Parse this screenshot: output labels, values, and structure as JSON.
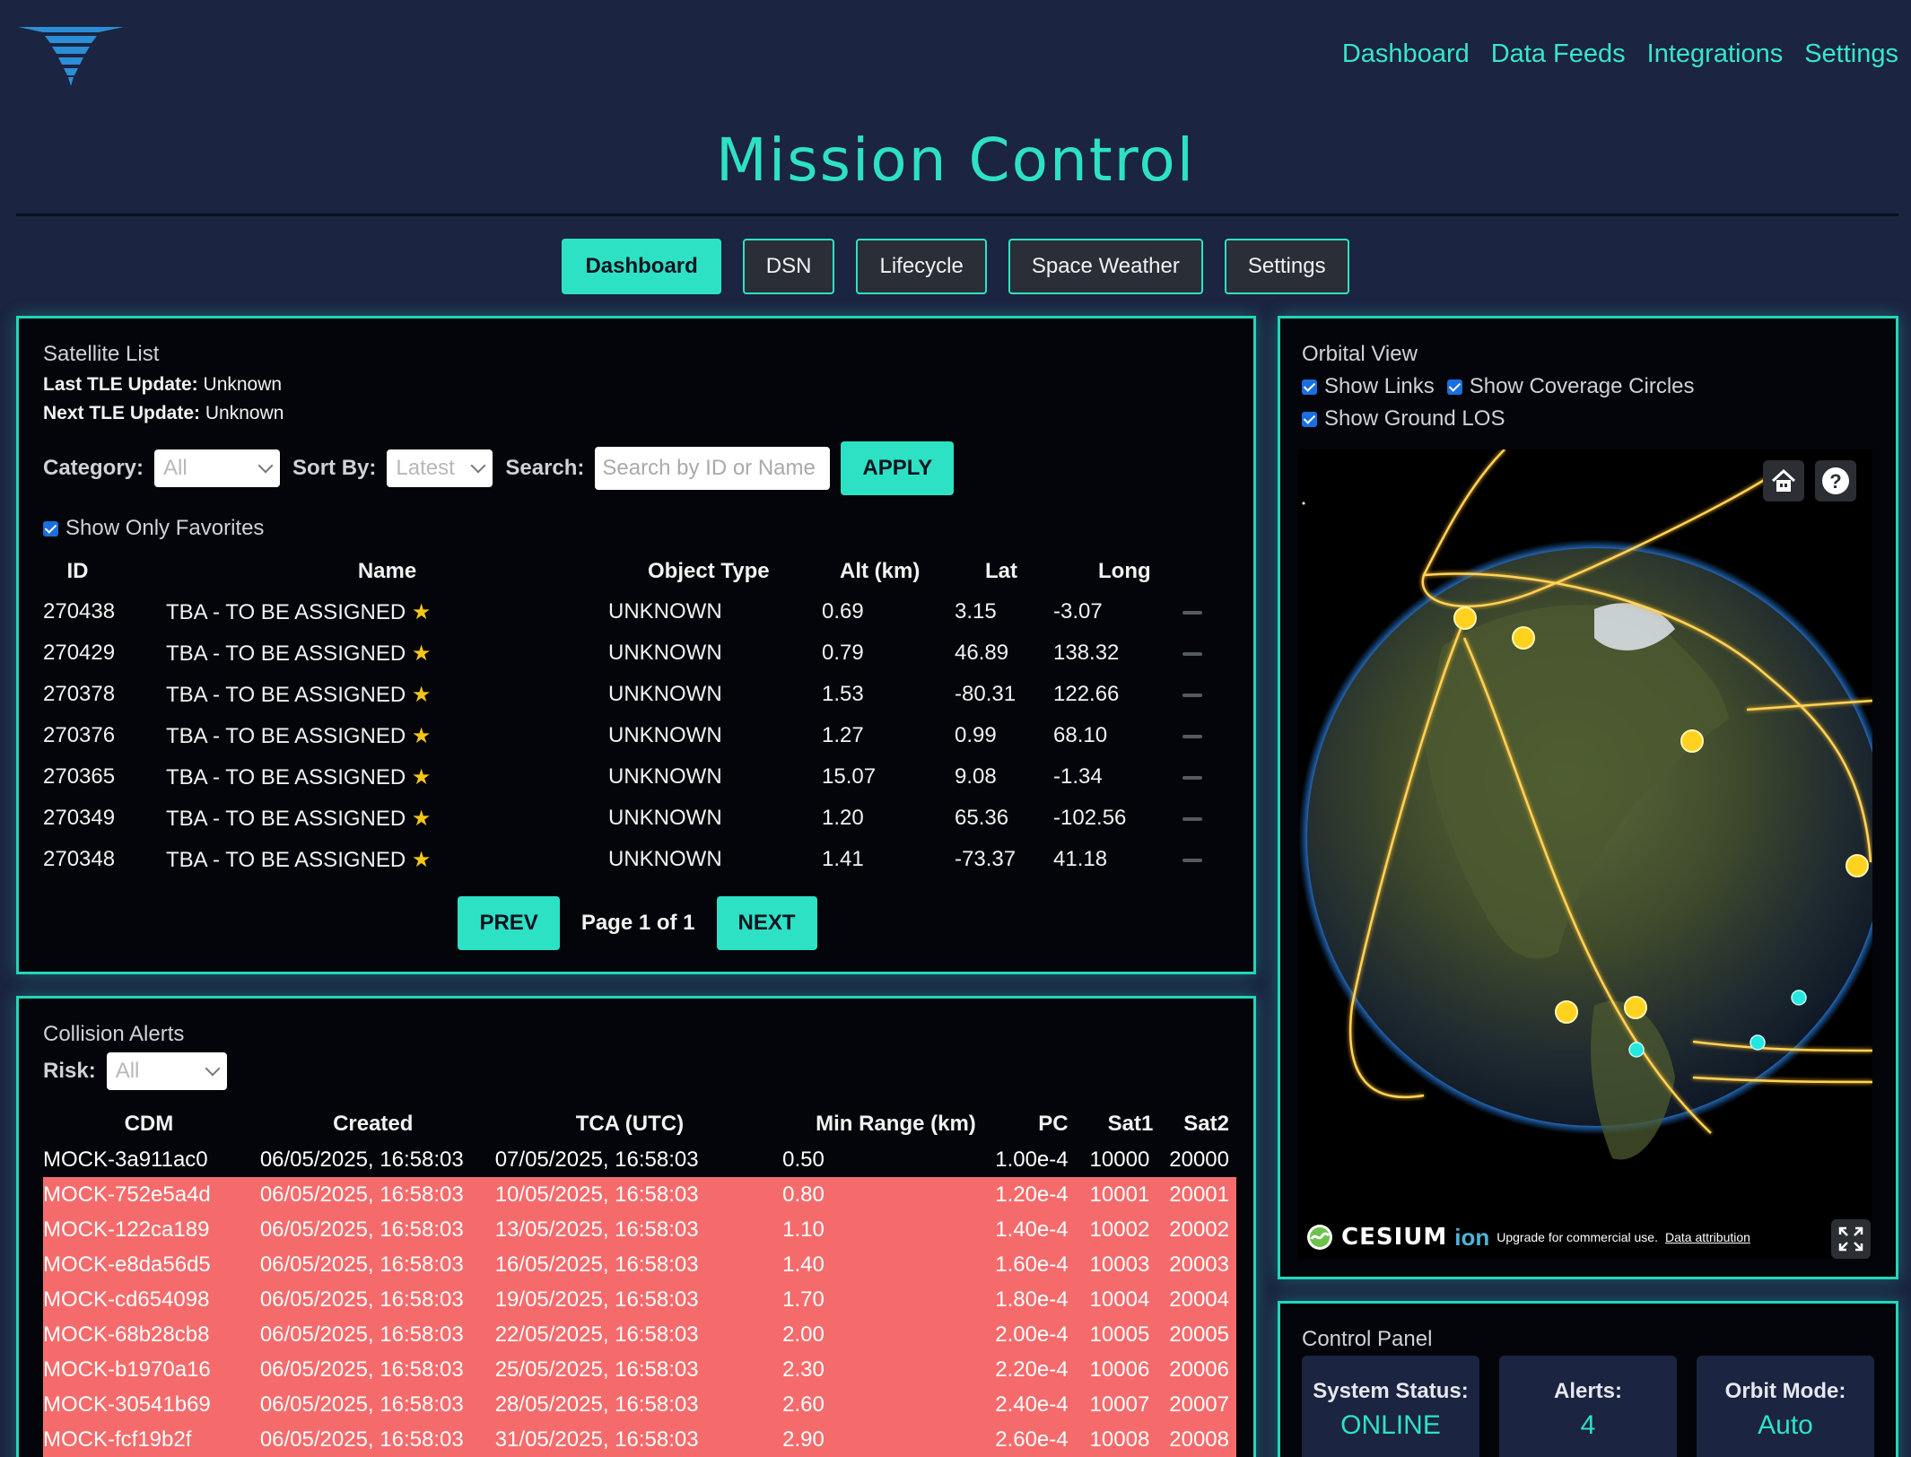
{
  "nav": {
    "links": [
      "Dashboard",
      "Data Feeds",
      "Integrations",
      "Settings"
    ]
  },
  "title": "Mission Control",
  "tabs": [
    "Dashboard",
    "DSN",
    "Lifecycle",
    "Space Weather",
    "Settings"
  ],
  "active_tab": "Dashboard",
  "satellite_list": {
    "title": "Satellite List",
    "last_tle_label": "Last TLE Update:",
    "last_tle_value": "Unknown",
    "next_tle_label": "Next TLE Update:",
    "next_tle_value": "Unknown",
    "category_label": "Category:",
    "category_value": "All",
    "sort_label": "Sort By:",
    "sort_value": "Latest",
    "search_label": "Search:",
    "search_placeholder": "Search by ID or Name",
    "apply_label": "APPLY",
    "favorites_label": "Show Only Favorites",
    "columns": [
      "ID",
      "Name",
      "Object Type",
      "Alt (km)",
      "Lat",
      "Long"
    ],
    "rows": [
      {
        "id": "270438",
        "name": "TBA - TO BE ASSIGNED",
        "type": "UNKNOWN",
        "alt": "0.69",
        "lat": "3.15",
        "long": "-3.07"
      },
      {
        "id": "270429",
        "name": "TBA - TO BE ASSIGNED",
        "type": "UNKNOWN",
        "alt": "0.79",
        "lat": "46.89",
        "long": "138.32"
      },
      {
        "id": "270378",
        "name": "TBA - TO BE ASSIGNED",
        "type": "UNKNOWN",
        "alt": "1.53",
        "lat": "-80.31",
        "long": "122.66"
      },
      {
        "id": "270376",
        "name": "TBA - TO BE ASSIGNED",
        "type": "UNKNOWN",
        "alt": "1.27",
        "lat": "0.99",
        "long": "68.10"
      },
      {
        "id": "270365",
        "name": "TBA - TO BE ASSIGNED",
        "type": "UNKNOWN",
        "alt": "15.07",
        "lat": "9.08",
        "long": "-1.34"
      },
      {
        "id": "270349",
        "name": "TBA - TO BE ASSIGNED",
        "type": "UNKNOWN",
        "alt": "1.20",
        "lat": "65.36",
        "long": "-102.56"
      },
      {
        "id": "270348",
        "name": "TBA - TO BE ASSIGNED",
        "type": "UNKNOWN",
        "alt": "1.41",
        "lat": "-73.37",
        "long": "41.18"
      }
    ],
    "prev_label": "PREV",
    "next_label": "NEXT",
    "page_text": "Page 1 of 1"
  },
  "collision_alerts": {
    "title": "Collision Alerts",
    "risk_label": "Risk:",
    "risk_value": "All",
    "columns": [
      "CDM",
      "Created",
      "TCA (UTC)",
      "Min Range (km)",
      "PC",
      "Sat1",
      "Sat2"
    ],
    "rows": [
      {
        "cdm": "MOCK-3a911ac0",
        "created": "06/05/2025, 16:58:03",
        "tca": "07/05/2025, 16:58:03",
        "range": "0.50",
        "pc": "1.00e-4",
        "sat1": "10000",
        "sat2": "20000",
        "high": false
      },
      {
        "cdm": "MOCK-752e5a4d",
        "created": "06/05/2025, 16:58:03",
        "tca": "10/05/2025, 16:58:03",
        "range": "0.80",
        "pc": "1.20e-4",
        "sat1": "10001",
        "sat2": "20001",
        "high": true
      },
      {
        "cdm": "MOCK-122ca189",
        "created": "06/05/2025, 16:58:03",
        "tca": "13/05/2025, 16:58:03",
        "range": "1.10",
        "pc": "1.40e-4",
        "sat1": "10002",
        "sat2": "20002",
        "high": true
      },
      {
        "cdm": "MOCK-e8da56d5",
        "created": "06/05/2025, 16:58:03",
        "tca": "16/05/2025, 16:58:03",
        "range": "1.40",
        "pc": "1.60e-4",
        "sat1": "10003",
        "sat2": "20003",
        "high": true
      },
      {
        "cdm": "MOCK-cd654098",
        "created": "06/05/2025, 16:58:03",
        "tca": "19/05/2025, 16:58:03",
        "range": "1.70",
        "pc": "1.80e-4",
        "sat1": "10004",
        "sat2": "20004",
        "high": true
      },
      {
        "cdm": "MOCK-68b28cb8",
        "created": "06/05/2025, 16:58:03",
        "tca": "22/05/2025, 16:58:03",
        "range": "2.00",
        "pc": "2.00e-4",
        "sat1": "10005",
        "sat2": "20005",
        "high": true
      },
      {
        "cdm": "MOCK-b1970a16",
        "created": "06/05/2025, 16:58:03",
        "tca": "25/05/2025, 16:58:03",
        "range": "2.30",
        "pc": "2.20e-4",
        "sat1": "10006",
        "sat2": "20006",
        "high": true
      },
      {
        "cdm": "MOCK-30541b69",
        "created": "06/05/2025, 16:58:03",
        "tca": "28/05/2025, 16:58:03",
        "range": "2.60",
        "pc": "2.40e-4",
        "sat1": "10007",
        "sat2": "20007",
        "high": true
      },
      {
        "cdm": "MOCK-fcf19b2f",
        "created": "06/05/2025, 16:58:03",
        "tca": "31/05/2025, 16:58:03",
        "range": "2.90",
        "pc": "2.60e-4",
        "sat1": "10008",
        "sat2": "20008",
        "high": true
      }
    ]
  },
  "orbital_view": {
    "title": "Orbital View",
    "show_links": "Show Links",
    "show_coverage": "Show Coverage Circles",
    "show_ground": "Show Ground LOS",
    "cesium_brand": "CESIUM",
    "cesium_ion": "ion",
    "upgrade_text": "Upgrade for commercial use.",
    "attribution_text": "Data attribution",
    "icons": [
      "home-icon",
      "help-icon",
      "fullscreen-icon"
    ]
  },
  "control_panel": {
    "title": "Control Panel",
    "cards": [
      {
        "label": "System Status:",
        "value": "ONLINE"
      },
      {
        "label": "Alerts:",
        "value": "4"
      },
      {
        "label": "Orbit Mode:",
        "value": "Auto"
      }
    ]
  },
  "colors": {
    "accent": "#2de2c4",
    "background": "#1b2440",
    "alert_row": "#f56b6c",
    "star": "#f5c518"
  }
}
